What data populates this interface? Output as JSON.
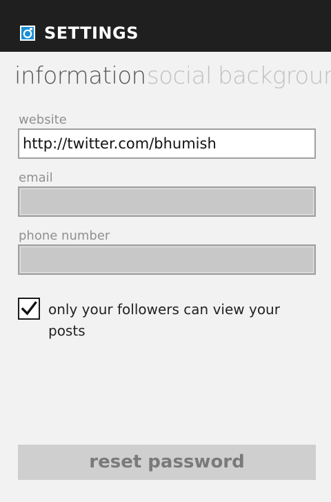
{
  "app": {
    "title": "SETTINGS",
    "icon": "instagram-camera-icon",
    "accent_color": "#1b8fd6"
  },
  "pivot": {
    "tabs": [
      {
        "label": "information",
        "active": true
      },
      {
        "label": "social",
        "active": false
      },
      {
        "label": "background",
        "active": false
      }
    ]
  },
  "form": {
    "website": {
      "label": "website",
      "value": "http://twitter.com/bhumish"
    },
    "email": {
      "label": "email",
      "value": ""
    },
    "phone": {
      "label": "phone number",
      "value": ""
    },
    "private_posts": {
      "label": "only your followers can view your posts",
      "checked": true
    }
  },
  "actions": {
    "reset_password": "reset password"
  }
}
